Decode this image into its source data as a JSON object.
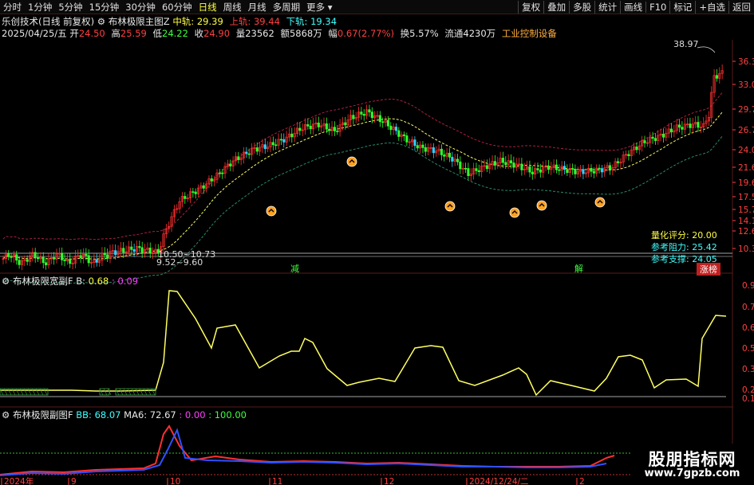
{
  "toolbar": {
    "timeframes": [
      "分时",
      "1分钟",
      "5分钟",
      "15分钟",
      "30分钟",
      "60分钟",
      "日线",
      "周线",
      "月线",
      "多周期",
      "更多"
    ],
    "active": "日线",
    "buttons": [
      "复权",
      "叠加",
      "多股",
      "统计",
      "画线",
      "F10",
      "标记",
      "+自选",
      "返回"
    ]
  },
  "header": {
    "stock_name": "乐创技术(日线 前复权)",
    "indicator": "布林极限主图Z",
    "mid_label": "中轨:",
    "mid_value": "29.39",
    "upper_label": "上轨:",
    "upper_value": "39.44",
    "lower_label": "下轨:",
    "lower_value": "19.34"
  },
  "quote": {
    "date": "2025/04/25/五",
    "open_label": "开",
    "open": "24.50",
    "high_label": "高",
    "high": "25.59",
    "low_label": "低",
    "low": "24.22",
    "close_label": "收",
    "close": "24.90",
    "vol_label": "量",
    "vol": "23562",
    "amt_label": "额",
    "amt": "5868万",
    "chg_label": "幅",
    "chg": "0.67(2.77%)",
    "turn_label": "换",
    "turn": "5.57%",
    "float_label": "流通",
    "float": "4230万",
    "sector": "工业控制设备"
  },
  "main_axis": [
    "36.3",
    "33.0",
    "29.7",
    "26.7",
    "24.0",
    "21.6",
    "19.6",
    "17.5",
    "15.7",
    "14.1",
    "12.6",
    "10.3"
  ],
  "annotations": {
    "peak": "38.97",
    "low_range1": "10.50~10.73",
    "low_range2": "9.52~9.60",
    "sig1": "减",
    "sig2": "解",
    "badge": "涨榜"
  },
  "legend": {
    "score_label": "量化评分:",
    "score": "20.00",
    "res_label": "参考阻力:",
    "res": "25.42",
    "sup_label": "参考支撑:",
    "sup": "24.05"
  },
  "panel2": {
    "name": "布林极限宽副F",
    "b_label": "B:",
    "b_value": "0.68",
    "b_extra": ": 0.09",
    "axis": [
      "0.9",
      "0.7",
      "0.6",
      "0.5",
      "0.3",
      "0.2",
      "0.1"
    ]
  },
  "panel3": {
    "name": "布林极限副图F",
    "bb_label": "BB:",
    "bb_value": "68.07",
    "ma_label": "MA6:",
    "ma_value": "72.67",
    "v1": ": 0.00",
    "v2": ": 100.00"
  },
  "date_axis": [
    "2024年",
    "9",
    "10",
    "11",
    "12",
    "2024/12/24/二",
    "2"
  ],
  "watermark": {
    "title": "股朋指标网",
    "url": "www.7gpzb.com"
  },
  "colors": {
    "up": "#ff3030",
    "down": "#30ff30",
    "mid": "#ffff60",
    "band": "#aa2040",
    "lower": "#2a8a6a"
  }
}
